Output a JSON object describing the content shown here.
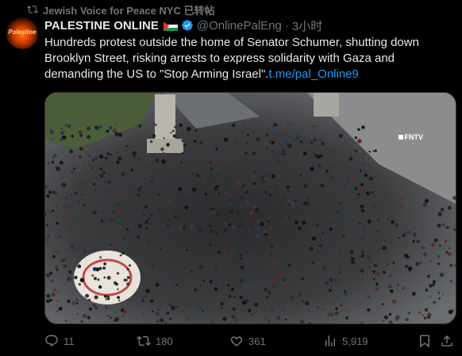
{
  "repost": {
    "text": "Jewish Voice for Peace NYC 已转帖"
  },
  "avatar": {
    "label": "Palestine"
  },
  "tweet": {
    "name": "PALESTINE ONLINE",
    "handle": "@OnlinePalEng",
    "separator": "·",
    "time": "3小时",
    "text": "Hundreds protest outside the home of Senator Schumer, shutting down Brooklyn Street, risking arrests to express solidarity with Gaza and demanding the US to \"Stop Arming Israel\".",
    "link": "t.me/pal_Online9"
  },
  "media": {
    "watermark": "FNTV"
  },
  "actions": {
    "replies": "11",
    "reposts": "180",
    "likes": "361",
    "views": "5,919"
  },
  "colors": {
    "background": "#000000",
    "text": "#e7e9ea",
    "muted": "#71767b",
    "link": "#1d9bf0",
    "verified": "#1d9bf0"
  }
}
